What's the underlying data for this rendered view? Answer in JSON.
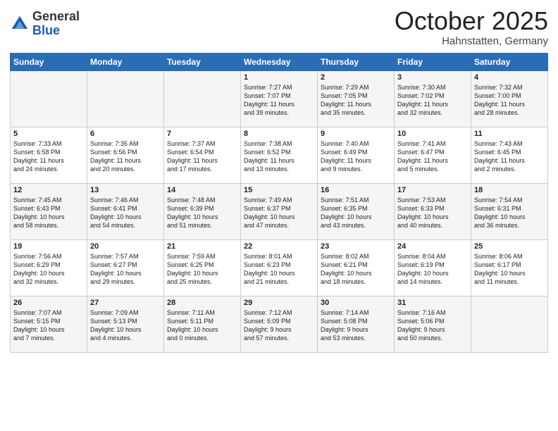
{
  "header": {
    "logo_general": "General",
    "logo_blue": "Blue",
    "month": "October 2025",
    "location": "Hahnstatten, Germany"
  },
  "days_of_week": [
    "Sunday",
    "Monday",
    "Tuesday",
    "Wednesday",
    "Thursday",
    "Friday",
    "Saturday"
  ],
  "weeks": [
    [
      {
        "day": "",
        "info": ""
      },
      {
        "day": "",
        "info": ""
      },
      {
        "day": "",
        "info": ""
      },
      {
        "day": "1",
        "info": "Sunrise: 7:27 AM\nSunset: 7:07 PM\nDaylight: 11 hours\nand 39 minutes."
      },
      {
        "day": "2",
        "info": "Sunrise: 7:29 AM\nSunset: 7:05 PM\nDaylight: 11 hours\nand 35 minutes."
      },
      {
        "day": "3",
        "info": "Sunrise: 7:30 AM\nSunset: 7:02 PM\nDaylight: 11 hours\nand 32 minutes."
      },
      {
        "day": "4",
        "info": "Sunrise: 7:32 AM\nSunset: 7:00 PM\nDaylight: 11 hours\nand 28 minutes."
      }
    ],
    [
      {
        "day": "5",
        "info": "Sunrise: 7:33 AM\nSunset: 6:58 PM\nDaylight: 11 hours\nand 24 minutes."
      },
      {
        "day": "6",
        "info": "Sunrise: 7:35 AM\nSunset: 6:56 PM\nDaylight: 11 hours\nand 20 minutes."
      },
      {
        "day": "7",
        "info": "Sunrise: 7:37 AM\nSunset: 6:54 PM\nDaylight: 11 hours\nand 17 minutes."
      },
      {
        "day": "8",
        "info": "Sunrise: 7:38 AM\nSunset: 6:52 PM\nDaylight: 11 hours\nand 13 minutes."
      },
      {
        "day": "9",
        "info": "Sunrise: 7:40 AM\nSunset: 6:49 PM\nDaylight: 11 hours\nand 9 minutes."
      },
      {
        "day": "10",
        "info": "Sunrise: 7:41 AM\nSunset: 6:47 PM\nDaylight: 11 hours\nand 5 minutes."
      },
      {
        "day": "11",
        "info": "Sunrise: 7:43 AM\nSunset: 6:45 PM\nDaylight: 11 hours\nand 2 minutes."
      }
    ],
    [
      {
        "day": "12",
        "info": "Sunrise: 7:45 AM\nSunset: 6:43 PM\nDaylight: 10 hours\nand 58 minutes."
      },
      {
        "day": "13",
        "info": "Sunrise: 7:46 AM\nSunset: 6:41 PM\nDaylight: 10 hours\nand 54 minutes."
      },
      {
        "day": "14",
        "info": "Sunrise: 7:48 AM\nSunset: 6:39 PM\nDaylight: 10 hours\nand 51 minutes."
      },
      {
        "day": "15",
        "info": "Sunrise: 7:49 AM\nSunset: 6:37 PM\nDaylight: 10 hours\nand 47 minutes."
      },
      {
        "day": "16",
        "info": "Sunrise: 7:51 AM\nSunset: 6:35 PM\nDaylight: 10 hours\nand 43 minutes."
      },
      {
        "day": "17",
        "info": "Sunrise: 7:53 AM\nSunset: 6:33 PM\nDaylight: 10 hours\nand 40 minutes."
      },
      {
        "day": "18",
        "info": "Sunrise: 7:54 AM\nSunset: 6:31 PM\nDaylight: 10 hours\nand 36 minutes."
      }
    ],
    [
      {
        "day": "19",
        "info": "Sunrise: 7:56 AM\nSunset: 6:29 PM\nDaylight: 10 hours\nand 32 minutes."
      },
      {
        "day": "20",
        "info": "Sunrise: 7:57 AM\nSunset: 6:27 PM\nDaylight: 10 hours\nand 29 minutes."
      },
      {
        "day": "21",
        "info": "Sunrise: 7:59 AM\nSunset: 6:25 PM\nDaylight: 10 hours\nand 25 minutes."
      },
      {
        "day": "22",
        "info": "Sunrise: 8:01 AM\nSunset: 6:23 PM\nDaylight: 10 hours\nand 21 minutes."
      },
      {
        "day": "23",
        "info": "Sunrise: 8:02 AM\nSunset: 6:21 PM\nDaylight: 10 hours\nand 18 minutes."
      },
      {
        "day": "24",
        "info": "Sunrise: 8:04 AM\nSunset: 6:19 PM\nDaylight: 10 hours\nand 14 minutes."
      },
      {
        "day": "25",
        "info": "Sunrise: 8:06 AM\nSunset: 6:17 PM\nDaylight: 10 hours\nand 11 minutes."
      }
    ],
    [
      {
        "day": "26",
        "info": "Sunrise: 7:07 AM\nSunset: 5:15 PM\nDaylight: 10 hours\nand 7 minutes."
      },
      {
        "day": "27",
        "info": "Sunrise: 7:09 AM\nSunset: 5:13 PM\nDaylight: 10 hours\nand 4 minutes."
      },
      {
        "day": "28",
        "info": "Sunrise: 7:11 AM\nSunset: 5:11 PM\nDaylight: 10 hours\nand 0 minutes."
      },
      {
        "day": "29",
        "info": "Sunrise: 7:12 AM\nSunset: 5:09 PM\nDaylight: 9 hours\nand 57 minutes."
      },
      {
        "day": "30",
        "info": "Sunrise: 7:14 AM\nSunset: 5:08 PM\nDaylight: 9 hours\nand 53 minutes."
      },
      {
        "day": "31",
        "info": "Sunrise: 7:16 AM\nSunset: 5:06 PM\nDaylight: 9 hours\nand 50 minutes."
      },
      {
        "day": "",
        "info": ""
      }
    ]
  ]
}
